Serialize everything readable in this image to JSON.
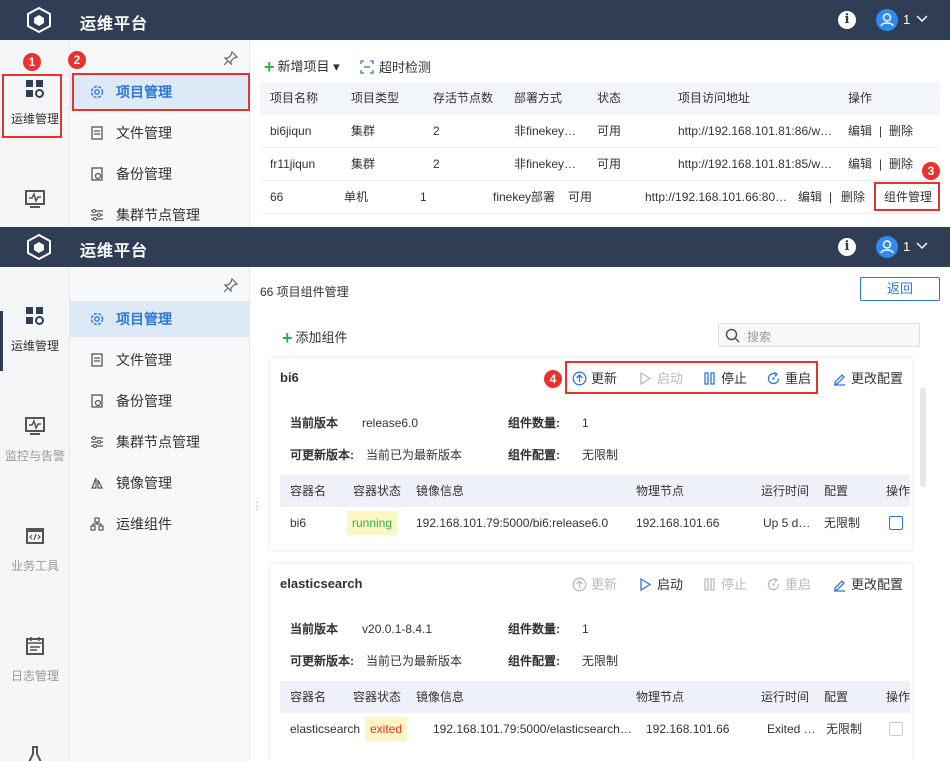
{
  "app": {
    "title": "运维平台",
    "user": "1"
  },
  "iconbar": {
    "ops": "运维管理",
    "monitor": "监控与告警",
    "biz": "业务工具",
    "log": "日志管理"
  },
  "subnav": {
    "items": [
      "项目管理",
      "文件管理",
      "备份管理",
      "集群节点管理",
      "镜像管理",
      "运维组件"
    ]
  },
  "badges": [
    "1",
    "2",
    "3",
    "4"
  ],
  "panel1": {
    "toolbar": {
      "new_project": "新增项目",
      "timeout_check": "超时检测"
    },
    "headers": [
      "项目名称",
      "项目类型",
      "存活节点数",
      "部署方式",
      "状态",
      "项目访问地址",
      "操作"
    ],
    "rows": [
      {
        "name": "bi6jiqun",
        "type": "集群",
        "nodes": "2",
        "deploy": "非finekey…",
        "status": "可用",
        "url": "http://192.168.101.81:86/w…",
        "edit": "编辑",
        "sep": "|",
        "delete": "删除"
      },
      {
        "name": "fr11jiqun",
        "type": "集群",
        "nodes": "2",
        "deploy": "非finekey…",
        "status": "可用",
        "url": "http://192.168.101.81:85/w…",
        "edit": "编辑",
        "sep": "|",
        "delete": "删除"
      },
      {
        "name": "66",
        "type": "单机",
        "nodes": "1",
        "deploy": "finekey部署",
        "status": "可用",
        "url": "http://192.168.101.66:80…",
        "edit": "编辑",
        "sep": "|",
        "delete": "删除",
        "comp": "组件管理"
      }
    ]
  },
  "panel2": {
    "breadcrumb": "66 项目组件管理",
    "back": "返回",
    "add_component": "添加组件",
    "search_placeholder": "搜索",
    "actions": {
      "update": "更新",
      "start": "启动",
      "stop": "停止",
      "restart": "重启",
      "config": "更改配置"
    },
    "labels": {
      "cur_ver": "当前版本",
      "upd_ver": "可更新版本:",
      "comp_count": "组件数量:",
      "comp_cfg": "组件配置:"
    },
    "col_headers": [
      "容器名",
      "容器状态",
      "镜像信息",
      "物理节点",
      "运行时间",
      "配置",
      "操作"
    ],
    "cards": [
      {
        "name": "bi6",
        "cur_ver": "release6.0",
        "upd_ver": "当前已为最新版本",
        "comp_count": "1",
        "comp_cfg": "无限制",
        "row": {
          "container": "bi6",
          "state": "running",
          "image": "192.168.101.79:5000/bi6:release6.0",
          "node": "192.168.101.66",
          "uptime": "Up 5 d…",
          "cfg": "无限制"
        }
      },
      {
        "name": "elasticsearch",
        "cur_ver": "v20.0.1-8.4.1",
        "upd_ver": "当前已为最新版本",
        "comp_count": "1",
        "comp_cfg": "无限制",
        "row": {
          "container": "elasticsearch",
          "state": "exited",
          "image": "192.168.101.79:5000/elasticsearch:…",
          "node": "192.168.101.66",
          "uptime": "Exited …",
          "cfg": "无限制"
        }
      }
    ]
  },
  "colors": {
    "header": "#2f3d55",
    "accent": "#2f78d1",
    "ok": "#2fb150",
    "alert": "#e8322e"
  }
}
